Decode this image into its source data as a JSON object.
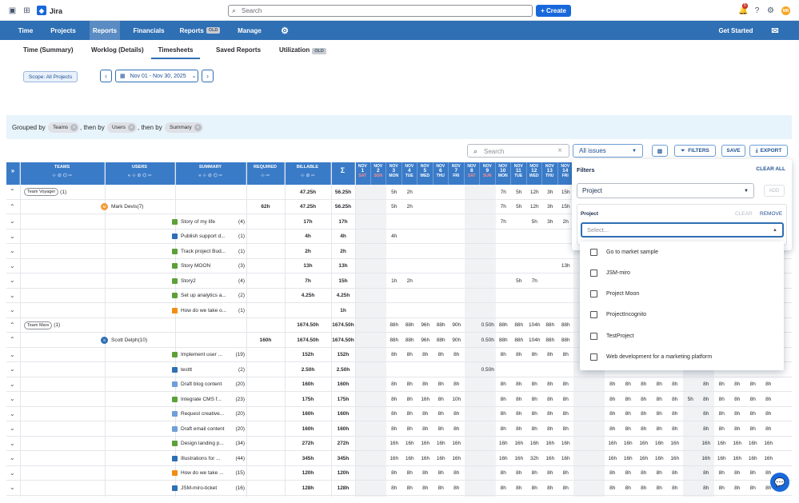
{
  "app": {
    "name": "Jira",
    "search_placeholder": "Search",
    "create_label": "+ Create",
    "notif_count": "5",
    "avatar": "MR"
  },
  "nav": {
    "items": [
      "Time",
      "Projects",
      "Reports",
      "Financials",
      "Reports",
      "Manage"
    ],
    "old_badge": "OLD",
    "get_started": "Get Started"
  },
  "subtabs": {
    "items": [
      "Time (Summary)",
      "Worklog (Details)",
      "Timesheets",
      "Saved Reports",
      "Utilization"
    ],
    "old_badge": "OLD"
  },
  "toolbar": {
    "scope": "Scope: All Projects",
    "date_range": "Nov 01 - Nov 30, 2025"
  },
  "grouping": {
    "grouped_by": "Grouped by",
    "then_by1": ", then by",
    "then_by2": ", then by",
    "chips": [
      "Teams",
      "Users",
      "Summary"
    ]
  },
  "table_tools": {
    "search_placeholder": "Search",
    "issue_filter": "All issues",
    "filters": "FILTERS",
    "save": "SAVE",
    "export": "EXPORT"
  },
  "columns": {
    "teams": "TEAMS",
    "users": "USERS",
    "summary": "SUMMARY",
    "required": "REQUIRED",
    "billable": "BILLABLE",
    "sigma": "Σ"
  },
  "days": [
    {
      "m": "NOV",
      "d": "1",
      "w": "SAT"
    },
    {
      "m": "NOV",
      "d": "2",
      "w": "SUN"
    },
    {
      "m": "NOV",
      "d": "3",
      "w": "MON"
    },
    {
      "m": "NOV",
      "d": "4",
      "w": "TUE"
    },
    {
      "m": "NOV",
      "d": "5",
      "w": "WED"
    },
    {
      "m": "NOV",
      "d": "6",
      "w": "THU"
    },
    {
      "m": "NOV",
      "d": "7",
      "w": "FRI"
    },
    {
      "m": "NOV",
      "d": "8",
      "w": "SAT"
    },
    {
      "m": "NOV",
      "d": "9",
      "w": "SUN"
    },
    {
      "m": "NOV",
      "d": "10",
      "w": "MON"
    },
    {
      "m": "NOV",
      "d": "11",
      "w": "TUE"
    },
    {
      "m": "NOV",
      "d": "12",
      "w": "WED"
    },
    {
      "m": "NOV",
      "d": "13",
      "w": "THU"
    },
    {
      "m": "NOV",
      "d": "14",
      "w": "FRI"
    }
  ],
  "rows": [
    {
      "type": "team",
      "team": "Team Voyager",
      "count": "(1)",
      "billable": "47.25h",
      "total": "56.25h",
      "days": [
        "",
        "",
        "5h",
        "2h",
        "",
        "",
        "",
        "",
        "",
        "7h",
        "5h",
        "12h",
        "3h",
        "15h"
      ]
    },
    {
      "type": "user",
      "user": "Mark Devis",
      "count": "(7)",
      "av": "M",
      "avc": "#f29a38",
      "required": "62h",
      "billable": "47.25h",
      "total": "56.25h",
      "days": [
        "",
        "",
        "5h",
        "2h",
        "",
        "",
        "",
        "",
        "",
        "7h",
        "5h",
        "12h",
        "3h",
        "15h"
      ]
    },
    {
      "type": "issue",
      "summary": "Story of my life",
      "count": "(4)",
      "ic": "#5da03a",
      "billable": "17h",
      "total": "17h",
      "days": [
        "",
        "",
        "",
        "",
        "",
        "",
        "",
        "",
        "",
        "7h",
        "",
        "5h",
        "3h",
        "2h"
      ]
    },
    {
      "type": "issue",
      "summary": "Publish support d...",
      "count": "(1)",
      "ic": "#2f6fb3",
      "billable": "4h",
      "total": "4h",
      "days": [
        "",
        "",
        "4h",
        "",
        "",
        "",
        "",
        "",
        "",
        "",
        "",
        "",
        "",
        ""
      ]
    },
    {
      "type": "issue",
      "summary": "Track project Bud...",
      "count": "(1)",
      "ic": "#5da03a",
      "billable": "2h",
      "total": "2h",
      "days": [
        "",
        "",
        "",
        "",
        "",
        "",
        "",
        "",
        "",
        "",
        "",
        "",
        "",
        ""
      ]
    },
    {
      "type": "issue",
      "summary": "Story MOON",
      "count": "(3)",
      "ic": "#5da03a",
      "billable": "13h",
      "total": "13h",
      "days": [
        "",
        "",
        "",
        "",
        "",
        "",
        "",
        "",
        "",
        "",
        "",
        "",
        "",
        "13h"
      ]
    },
    {
      "type": "issue",
      "summary": "Story2",
      "count": "(4)",
      "ic": "#5da03a",
      "billable": "7h",
      "total": "15h",
      "days": [
        "",
        "",
        "1h",
        "2h",
        "",
        "",
        "",
        "",
        "",
        "",
        "5h",
        "7h",
        "",
        ""
      ]
    },
    {
      "type": "issue",
      "summary": "Set up analytics a...",
      "count": "(2)",
      "ic": "#5da03a",
      "billable": "4.25h",
      "total": "4.25h",
      "days": [
        "",
        "",
        "",
        "",
        "",
        "",
        "",
        "",
        "",
        "",
        "",
        "",
        "",
        ""
      ]
    },
    {
      "type": "issue",
      "summary": "How do we take o...",
      "count": "(1)",
      "ic": "#f18d13",
      "billable": "",
      "total": "1h",
      "days": [
        "",
        "",
        "",
        "",
        "",
        "",
        "",
        "",
        "",
        "",
        "",
        "",
        "",
        ""
      ]
    },
    {
      "type": "team",
      "team": "Team Mars",
      "count": "(1)",
      "billable": "1674.50h",
      "total": "1674.50h",
      "days": [
        "",
        "",
        "88h",
        "88h",
        "96h",
        "88h",
        "90h",
        "",
        "0.50h",
        "88h",
        "88h",
        "104h",
        "88h",
        "88h"
      ]
    },
    {
      "type": "user",
      "user": "Scott Delph",
      "count": "(10)",
      "av": "S",
      "avc": "#2f6fb3",
      "required": "160h",
      "billable": "1674.50h",
      "total": "1674.50h",
      "days": [
        "",
        "",
        "88h",
        "88h",
        "96h",
        "88h",
        "90h",
        "",
        "0.50h",
        "88h",
        "88h",
        "104h",
        "88h",
        "88h"
      ]
    },
    {
      "type": "issue",
      "summary": "Implement user ...",
      "count": "(19)",
      "ic": "#5da03a",
      "billable": "152h",
      "total": "152h",
      "days": [
        "",
        "",
        "8h",
        "8h",
        "8h",
        "8h",
        "8h",
        "",
        "",
        "8h",
        "8h",
        "8h",
        "8h",
        "8h"
      ]
    },
    {
      "type": "issue",
      "summary": "testtt",
      "count": "(2)",
      "ic": "#2f6fb3",
      "billable": "2.50h",
      "total": "2.50h",
      "days": [
        "",
        "",
        "",
        "",
        "",
        "",
        "",
        "",
        "0.50h",
        "",
        "",
        "",
        "",
        ""
      ]
    },
    {
      "type": "issue",
      "summary": "Draft blog content",
      "count": "(20)",
      "ic": "#6f9fd8",
      "billable": "160h",
      "total": "160h",
      "days": [
        "",
        "",
        "8h",
        "8h",
        "8h",
        "8h",
        "8h",
        "",
        "",
        "8h",
        "8h",
        "8h",
        "8h",
        "8h"
      ]
    },
    {
      "type": "issue",
      "summary": "Integrate CMS f...",
      "count": "(23)",
      "ic": "#5da03a",
      "billable": "175h",
      "total": "175h",
      "days": [
        "",
        "",
        "8h",
        "8h",
        "16h",
        "8h",
        "10h",
        "",
        "",
        "8h",
        "8h",
        "8h",
        "8h",
        "8h"
      ]
    },
    {
      "type": "issue",
      "summary": "Request creative...",
      "count": "(20)",
      "ic": "#6f9fd8",
      "billable": "160h",
      "total": "160h",
      "days": [
        "",
        "",
        "8h",
        "8h",
        "8h",
        "8h",
        "8h",
        "",
        "",
        "8h",
        "8h",
        "8h",
        "8h",
        "8h"
      ]
    },
    {
      "type": "issue",
      "summary": "Draft email content",
      "count": "(20)",
      "ic": "#6f9fd8",
      "billable": "160h",
      "total": "160h",
      "days": [
        "",
        "",
        "8h",
        "8h",
        "8h",
        "8h",
        "8h",
        "",
        "",
        "8h",
        "8h",
        "8h",
        "8h",
        "8h"
      ]
    },
    {
      "type": "issue",
      "summary": "Design landing p...",
      "count": "(34)",
      "ic": "#5da03a",
      "billable": "272h",
      "total": "272h",
      "days": [
        "",
        "",
        "16h",
        "16h",
        "16h",
        "16h",
        "16h",
        "",
        "",
        "16h",
        "16h",
        "16h",
        "16h",
        "16h"
      ]
    },
    {
      "type": "issue",
      "summary": "Illustrations for ...",
      "count": "(44)",
      "ic": "#2f6fb3",
      "billable": "345h",
      "total": "345h",
      "days": [
        "",
        "",
        "16h",
        "16h",
        "16h",
        "16h",
        "16h",
        "",
        "",
        "16h",
        "16h",
        "32h",
        "16h",
        "16h"
      ]
    },
    {
      "type": "issue",
      "summary": "How do we take ...",
      "count": "(15)",
      "ic": "#f18d13",
      "billable": "120h",
      "total": "120h",
      "days": [
        "",
        "",
        "8h",
        "8h",
        "8h",
        "8h",
        "8h",
        "",
        "",
        "8h",
        "8h",
        "8h",
        "8h",
        "8h"
      ]
    },
    {
      "type": "issue",
      "summary": "JSM-miro-ticket",
      "count": "(16)",
      "ic": "#2f6fb3",
      "billable": "128h",
      "total": "128h",
      "days": [
        "",
        "",
        "8h",
        "8h",
        "8h",
        "8h",
        "8h",
        "",
        "",
        "8h",
        "8h",
        "8h",
        "8h",
        "8h"
      ]
    }
  ],
  "right_cols": [
    {
      "row": 13,
      "vals": [
        "8h",
        "8h",
        "8h",
        "8h",
        "8h",
        "",
        "",
        "8h",
        "8h",
        "8h",
        "8h",
        "8h"
      ]
    },
    {
      "row": 14,
      "vals": [
        "8h",
        "8h",
        "8h",
        "8h",
        "8h",
        "5h",
        "",
        "8h",
        "8h",
        "8h",
        "8h",
        "8h"
      ]
    },
    {
      "row": 15,
      "vals": [
        "8h",
        "8h",
        "8h",
        "8h",
        "8h",
        "",
        "",
        "8h",
        "8h",
        "8h",
        "8h",
        "8h"
      ]
    },
    {
      "row": 16,
      "vals": [
        "8h",
        "8h",
        "8h",
        "8h",
        "8h",
        "",
        "",
        "8h",
        "8h",
        "8h",
        "8h",
        "8h"
      ]
    },
    {
      "row": 17,
      "vals": [
        "16h",
        "16h",
        "16h",
        "16h",
        "16h",
        "",
        "",
        "16h",
        "16h",
        "16h",
        "16h",
        "16h"
      ]
    },
    {
      "row": 18,
      "vals": [
        "16h",
        "16h",
        "16h",
        "16h",
        "16h",
        "",
        "",
        "16h",
        "16h",
        "16h",
        "16h",
        "16h"
      ]
    },
    {
      "row": 19,
      "vals": [
        "8h",
        "8h",
        "8h",
        "8h",
        "8h",
        "",
        "",
        "8h",
        "8h",
        "8h",
        "8h",
        "8h"
      ]
    },
    {
      "row": 20,
      "vals": [
        "8h",
        "8h",
        "8h",
        "8h",
        "8h",
        "",
        "",
        "8h",
        "8h",
        "8h",
        "8h",
        "8h"
      ]
    }
  ],
  "filters": {
    "title": "Filters",
    "clear_all": "CLEAR ALL",
    "field": "Project",
    "add": "ADD",
    "section": "Project",
    "clear": "CLEAR",
    "remove": "REMOVE",
    "select_placeholder": "Select...",
    "options": [
      "Go to market sample",
      "JSM-miro",
      "Project Moon",
      "ProjectIncognito",
      "TestProject",
      "Web development for a marketing platform"
    ]
  }
}
